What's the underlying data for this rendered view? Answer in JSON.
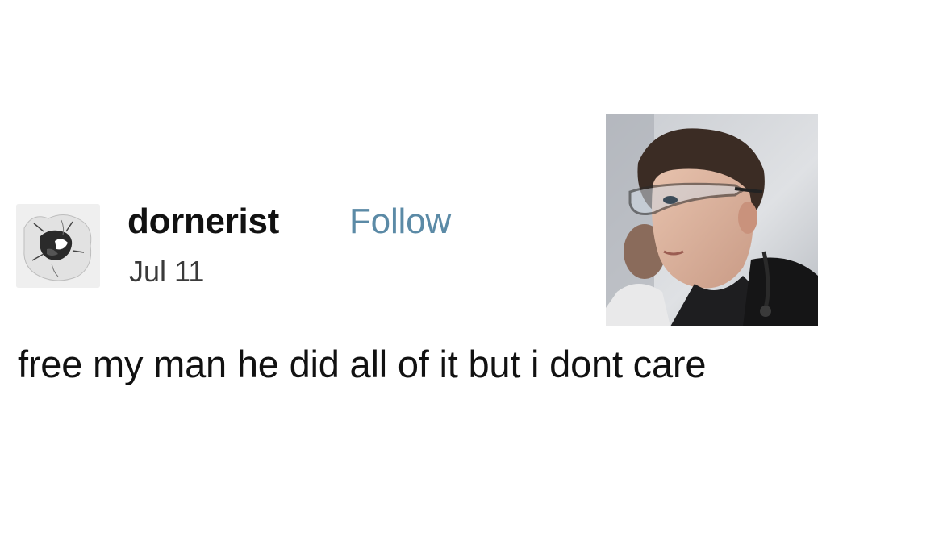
{
  "post": {
    "username": "dornerist",
    "follow_label": "Follow",
    "date": "Jul 11",
    "text": "free my man he did all of it but i dont care"
  },
  "avatar": {
    "icon": "sketch-drawing-avatar"
  },
  "image": {
    "icon": "photo-man-in-safety-glasses"
  },
  "colors": {
    "follow": "#5b8aa6",
    "text": "#111111",
    "date": "#3a3a3a",
    "background": "#ffffff"
  }
}
